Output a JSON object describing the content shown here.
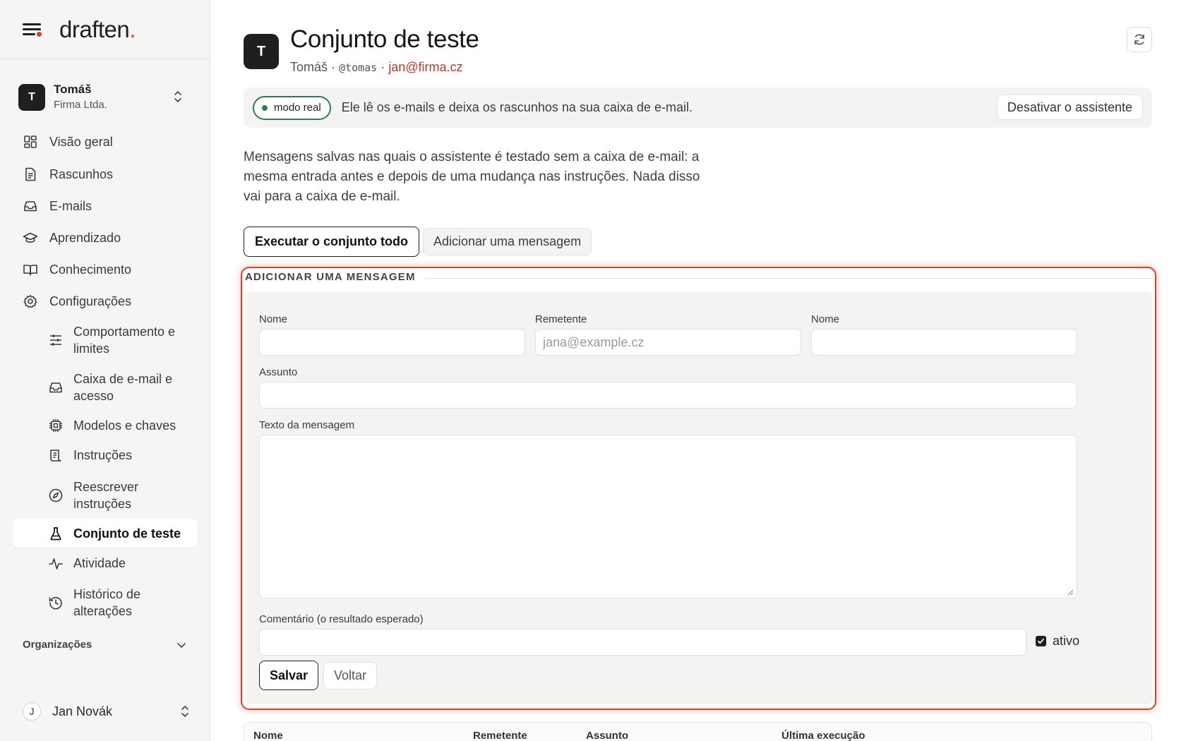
{
  "brand": {
    "name": "draften",
    "dot": "."
  },
  "workspace": {
    "avatar": "T",
    "name": "Tomáš",
    "org": "Firma Ltda."
  },
  "nav": {
    "overview": "Visão geral",
    "drafts": "Rascunhos",
    "emails": "E-mails",
    "learning": "Aprendizado",
    "knowledge": "Conhecimento",
    "settings": "Configurações",
    "behavior": "Comportamento e limites",
    "mailbox": "Caixa de e-mail e acesso",
    "models": "Modelos e chaves",
    "instructions": "Instruções",
    "rewrite": "Reescrever instruções",
    "testset": "Conjunto de teste",
    "activity": "Atividade",
    "history": "Histórico de alterações"
  },
  "organizations": {
    "label": "Organizações"
  },
  "user": {
    "avatar": "J",
    "name": "Jan Novák"
  },
  "page": {
    "avatar": "T",
    "title": "Conjunto de teste",
    "owner": "Tomáš",
    "sep1": " · ",
    "handle": "@tomas",
    "sep2": " · ",
    "email": "jan@firma.cz"
  },
  "mode": {
    "badge": "modo real",
    "text": "Ele lê os e-mails e deixa os rascunhos na sua caixa de e-mail.",
    "disable_label": "Desativar o assistente",
    "status_color": "#2f7d4f"
  },
  "description": "Mensagens salvas nas quais o assistente é testado sem a caixa de e-mail: a mesma entrada antes e depois de uma mudança nas instruções. Nada disso vai para a caixa de e-mail.",
  "actions": {
    "run_all": "Executar o conjunto todo",
    "add_message": "Adicionar uma mensagem"
  },
  "form": {
    "legend": "ADICIONAR UMA MENSAGEM",
    "name_label": "Nome",
    "name_value": "",
    "sender_label": "Remetente",
    "sender_placeholder": "jana@example.cz",
    "sender_value": "",
    "sender_name_label": "Nome",
    "sender_name_value": "",
    "subject_label": "Assunto",
    "subject_value": "",
    "body_label": "Texto da mensagem",
    "body_value": "",
    "comment_label": "Comentário (o resultado esperado)",
    "comment_value": "",
    "active_label": "ativo",
    "active_checked": true,
    "save_label": "Salvar",
    "back_label": "Voltar",
    "highlight_color": "#d9402b"
  },
  "table": {
    "columns": [
      "Nome",
      "Remetente",
      "Assunto",
      "Última execução"
    ]
  }
}
